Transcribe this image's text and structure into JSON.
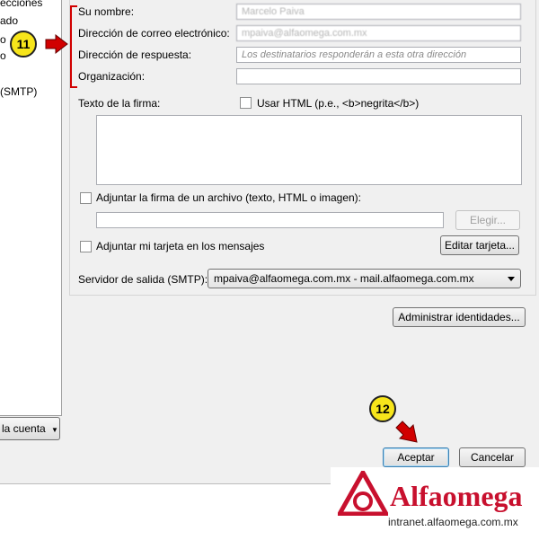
{
  "sidebar": {
    "items": [
      {
        "label": "ecciones"
      },
      {
        "label": "ado"
      },
      {
        "label": "o"
      },
      {
        "label": "o"
      },
      {
        "label": "(SMTP)"
      }
    ],
    "account_actions_label": "la cuenta"
  },
  "identity": {
    "name_label": "Su nombre:",
    "name_value": "Marcelo Paiva",
    "email_label": "Dirección de correo electrónico:",
    "email_value": "mpaiva@alfaomega.com.mx",
    "reply_label": "Dirección de respuesta:",
    "reply_placeholder": "Los destinatarios responderán a esta otra dirección",
    "org_label": "Organización:",
    "org_value": ""
  },
  "signature": {
    "label": "Texto de la firma:",
    "use_html_label": "Usar HTML (p.e., <b>negrita</b>)",
    "use_html_checked": false,
    "attach_file_label": "Adjuntar la firma de un archivo (texto, HTML o imagen):",
    "attach_file_checked": false,
    "file_path": "",
    "choose_label": "Elegir...",
    "attach_card_label": "Adjuntar mi tarjeta en los mensajes",
    "attach_card_checked": false,
    "edit_card_label": "Editar tarjeta..."
  },
  "smtp": {
    "label": "Servidor de salida (SMTP):",
    "selected": "mpaiva@alfaomega.com.mx - mail.alfaomega.com.mx"
  },
  "manage_identities_label": "Administrar identidades...",
  "dialog": {
    "ok_label": "Aceptar",
    "cancel_label": "Cancelar"
  },
  "annotations": {
    "step_11": "11",
    "step_12": "12"
  },
  "brand": {
    "name": "Alfaomega",
    "url": "intranet.alfaomega.com.mx",
    "color": "#c8102e"
  },
  "colors": {
    "badge": "#f7e51b",
    "arrow": "#d10000",
    "ok_border": "#3c7fb1"
  }
}
